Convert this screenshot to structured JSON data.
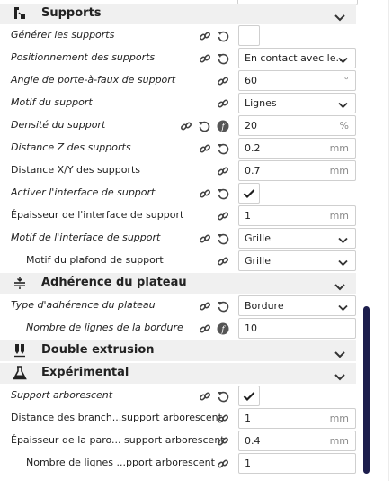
{
  "sections": {
    "supports": {
      "title": "Supports"
    },
    "adhesion": {
      "title": "Adhérence du plateau"
    },
    "dual": {
      "title": "Double extrusion"
    },
    "experimental": {
      "title": "Expérimental"
    }
  },
  "settings": {
    "support_enable": {
      "label": "Générer les supports",
      "checked": false
    },
    "support_type": {
      "label": "Positionnement des supports",
      "value": "En contact avec le..."
    },
    "support_angle": {
      "label": "Angle de porte-à-faux de support",
      "value": "60",
      "unit": "°"
    },
    "support_pattern": {
      "label": "Motif du support",
      "value": "Lignes"
    },
    "support_density": {
      "label": "Densité du support",
      "value": "20",
      "unit": "%"
    },
    "support_z_distance": {
      "label": "Distance Z des supports",
      "value": "0.2",
      "unit": "mm"
    },
    "support_xy_distance": {
      "label": "Distance X/Y des supports",
      "value": "0.7",
      "unit": "mm"
    },
    "support_interface_enable": {
      "label": "Activer l'interface de support",
      "checked": true
    },
    "support_interface_height": {
      "label": "Épaisseur de l'interface de support",
      "value": "1",
      "unit": "mm"
    },
    "support_interface_pattern": {
      "label": "Motif de l'interface de support",
      "value": "Grille"
    },
    "support_roof_pattern": {
      "label": "Motif du plafond de support",
      "value": "Grille"
    },
    "adhesion_type": {
      "label": "Type d'adhérence du plateau",
      "value": "Bordure"
    },
    "brim_line_count": {
      "label": "Nombre de lignes de la bordure",
      "value": "10"
    },
    "support_tree_enable": {
      "label": "Support arborescent",
      "checked": true
    },
    "support_tree_branch_distance": {
      "label": "Distance des branch...support arborescent",
      "value": "1",
      "unit": "mm"
    },
    "support_tree_wall_thickness": {
      "label": "Épaisseur de la paro... support arborescent",
      "value": "0.4",
      "unit": "mm"
    },
    "support_tree_wall_count": {
      "label": "Nombre de lignes ...pport arborescent",
      "value": "1"
    }
  },
  "icons": {
    "link": "chain-link-icon",
    "reset": "reset-icon",
    "function": "function-icon",
    "chevron": "chevron-down-icon"
  },
  "colors": {
    "category_bg": "#f0f0f0",
    "scrollbar": "#1d1e4d",
    "field_border": "#cfcfcf"
  }
}
